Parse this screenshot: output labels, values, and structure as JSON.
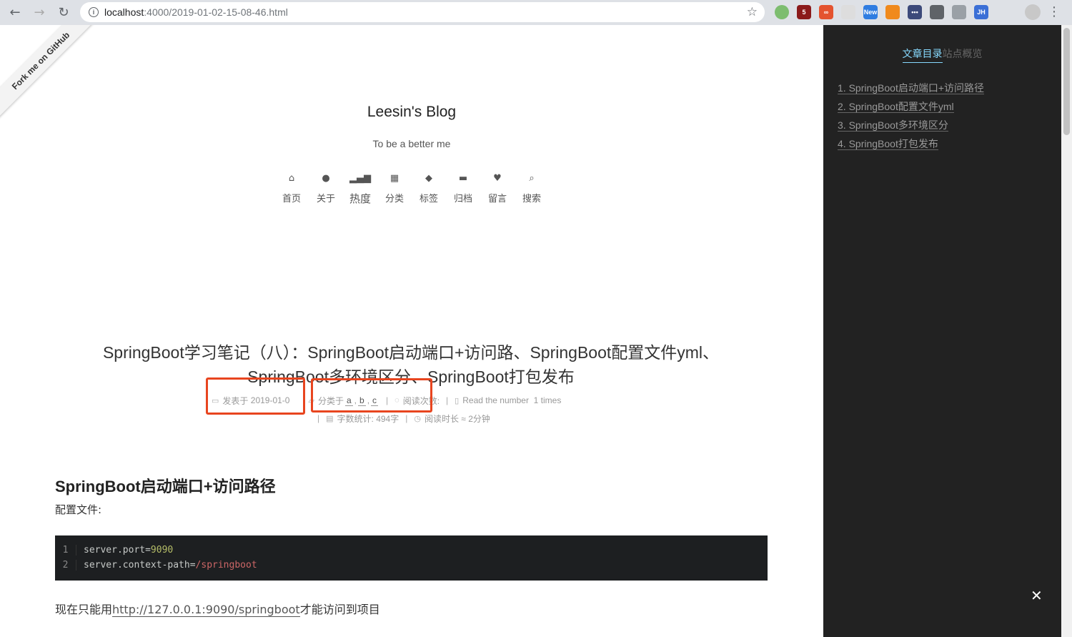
{
  "browser": {
    "url_host": "localhost",
    "url_path": ":4000/2019-01-02-15-08-46.html",
    "extensions": [
      {
        "name": "green-dot-extension",
        "text": "",
        "color": "#7dbd6f"
      },
      {
        "name": "ublock-extension",
        "text": "5",
        "color": "#8b1a1a"
      },
      {
        "name": "infinity-extension",
        "text": "∞",
        "color": "#e4532f"
      },
      {
        "name": "bookmark-extension",
        "text": "",
        "color": "#dddddd"
      },
      {
        "name": "new-extension",
        "text": "New",
        "color": "#2f7de1"
      },
      {
        "name": "arrow-extension",
        "text": "",
        "color": "#f08a1c"
      },
      {
        "name": "dots-extension",
        "text": "•••",
        "color": "#3c4a7a"
      },
      {
        "name": "glasses-extension",
        "text": "",
        "color": "#5f6368"
      },
      {
        "name": "link-extension",
        "text": "",
        "color": "#9aa0a6"
      },
      {
        "name": "jh-extension",
        "text": "JH",
        "color": "#3b6fd6"
      }
    ]
  },
  "ribbon": {
    "label": "Fork me on GitHub"
  },
  "site": {
    "title": "Leesin's Blog",
    "subtitle": "To be a better me"
  },
  "menu": [
    {
      "name": "home",
      "icon": "⌂",
      "label": "首页"
    },
    {
      "name": "about",
      "icon": "●",
      "label": "关于"
    },
    {
      "name": "hot",
      "icon": "▂▄▆",
      "label": "热度"
    },
    {
      "name": "categories",
      "icon": "▦",
      "label": "分类"
    },
    {
      "name": "tags",
      "icon": "◆",
      "label": "标签"
    },
    {
      "name": "archives",
      "icon": "▬",
      "label": "归档"
    },
    {
      "name": "guestbook",
      "icon": "♥",
      "label": "留言"
    },
    {
      "name": "search",
      "icon": "⌕",
      "label": "搜索"
    }
  ],
  "post": {
    "title": "SpringBoot学习笔记（八）：SpringBoot启动端口+访问路、SpringBoot配置文件yml、SpringBoot多环境区分、SpringBoot打包发布",
    "posted_label": "发表于",
    "posted_date": "2019-01-0",
    "category_label": "分类于",
    "categories": [
      "a",
      "b",
      "c"
    ],
    "views_label": "阅读次数:",
    "read_number_label": "Read the number",
    "read_number_value": "1",
    "read_number_unit": "times",
    "word_count": "字数统计: 494字",
    "read_time": "阅读时长 ≈ 2分钟"
  },
  "content": {
    "heading": "SpringBoot启动端口+访问路径",
    "para1": "配置文件:",
    "code_lines": [
      {
        "num": "1",
        "key": "server.port=",
        "val": "9090",
        "val_color": "green"
      },
      {
        "num": "2",
        "key": "server.context-path=",
        "val": "/springboot",
        "val_color": "red"
      }
    ],
    "para2_prefix": "现在只能用",
    "para2_link": "http://127.0.0.1:9090/springboot",
    "para2_suffix": "才能访问到项目"
  },
  "sidebar": {
    "tab_toc": "文章目录",
    "tab_overview": "站点概览",
    "toc": [
      "1. SpringBoot启动端口+访问路径",
      "2. SpringBoot配置文件yml",
      "3. SpringBoot多环境区分",
      "4. SpringBoot打包发布"
    ],
    "close": "✕"
  },
  "colors": {
    "highlight": "#e8451f",
    "sidebar_bg": "#222222",
    "toc_accent": "#87daff"
  }
}
